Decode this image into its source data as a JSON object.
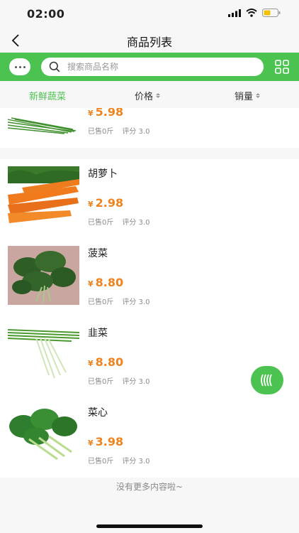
{
  "status": {
    "time": "02:00"
  },
  "nav": {
    "title": "商品列表"
  },
  "search": {
    "placeholder": "搜索商品名称"
  },
  "filters": [
    {
      "label": "新鲜蔬菜",
      "active": true
    },
    {
      "label": "价格",
      "sortable": true
    },
    {
      "label": "销量",
      "sortable": true
    }
  ],
  "currency": "¥",
  "products": [
    {
      "name": "",
      "price": "5.98",
      "sold": "已售0斤",
      "rating": "评分 3.0",
      "image": "chive-image"
    },
    {
      "name": "胡萝卜",
      "price": "2.98",
      "sold": "已售0斤",
      "rating": "评分 3.0",
      "image": "carrot-image"
    },
    {
      "name": "菠菜",
      "price": "8.80",
      "sold": "已售0斤",
      "rating": "评分 3.0",
      "image": "spinach-image"
    },
    {
      "name": "韭菜",
      "price": "8.80",
      "sold": "已售0斤",
      "rating": "评分 3.0",
      "image": "chive-image"
    },
    {
      "name": "菜心",
      "price": "3.98",
      "sold": "已售0斤",
      "rating": "评分 3.0",
      "image": "choy-sum-image"
    }
  ],
  "footer": {
    "no_more": "没有更多内容啦~"
  },
  "colors": {
    "brand": "#4cc350",
    "price": "#f0831e"
  }
}
